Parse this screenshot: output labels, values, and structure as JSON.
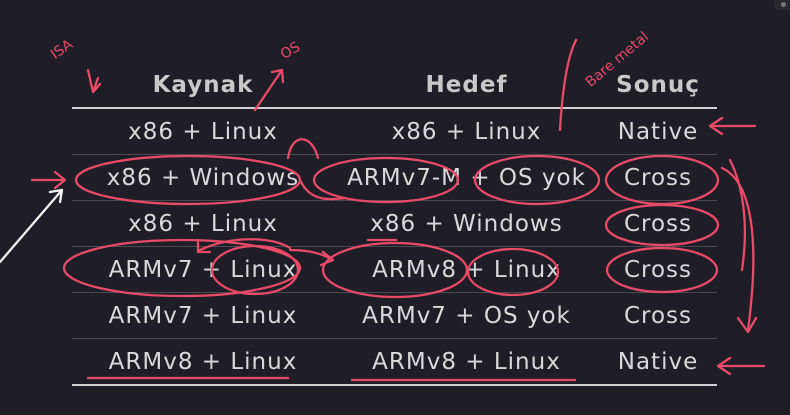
{
  "table": {
    "headers": [
      "Kaynak",
      "Hedef",
      "Sonuç"
    ],
    "rows": [
      [
        "x86 + Linux",
        "x86 + Linux",
        "Native"
      ],
      [
        "x86 + Windows",
        "ARMv7-M + OS yok",
        "Cross"
      ],
      [
        "x86 + Linux",
        "x86 + Windows",
        "Cross"
      ],
      [
        "ARMv7 + Linux",
        "ARMv8 + Linux",
        "Cross"
      ],
      [
        "ARMv7 + Linux",
        "ARMv7 + OS yok",
        "Cross"
      ],
      [
        "ARMv8 + Linux",
        "ARMv8 + Linux",
        "Native"
      ]
    ]
  },
  "annotations": {
    "isa_note": "ISA",
    "os_note": "OS",
    "bare_metal_note": "Bare metal"
  },
  "colors": {
    "background": "#1f1e26",
    "text": "#d9d9d9",
    "ink": "#e84a6a"
  }
}
